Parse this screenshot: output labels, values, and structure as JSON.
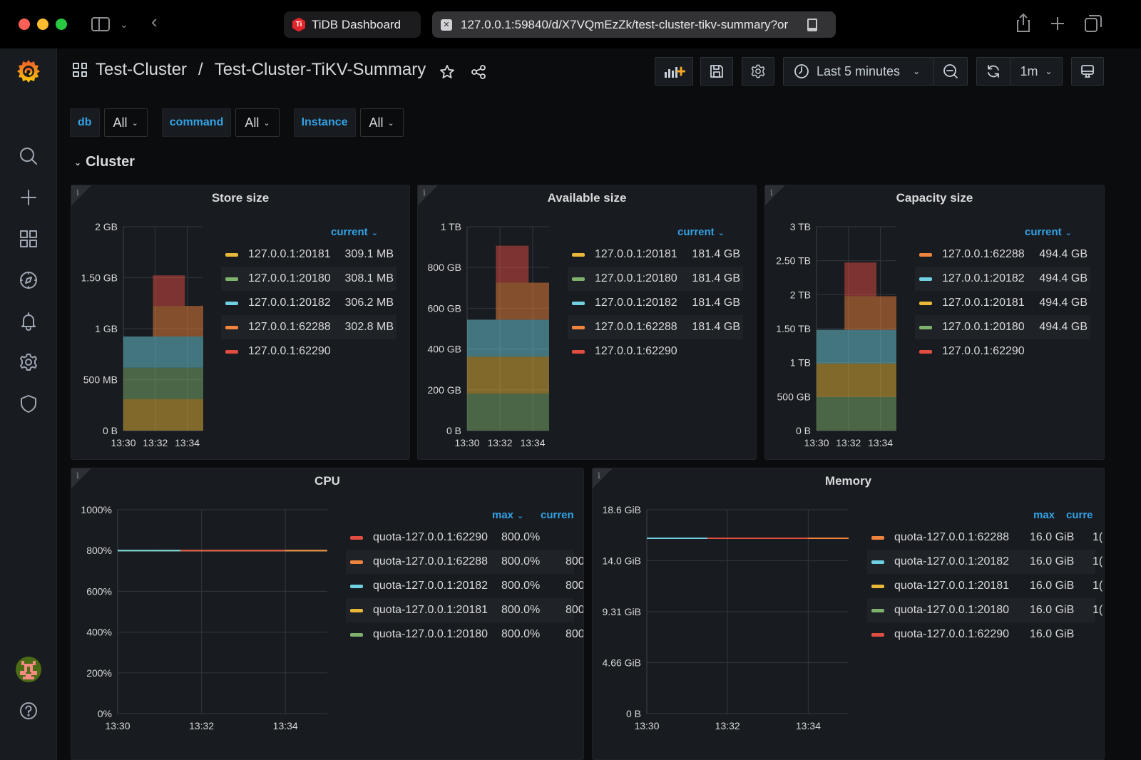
{
  "browser": {
    "tabs": [
      {
        "label": "TiDB Dashboard",
        "icon": "tidb-logo"
      },
      {
        "label": "127.0.0.1:59840/d/X7VQmEzZk/test-cluster-tikv-summary?or",
        "icon": "close-icon"
      }
    ]
  },
  "breadcrumb": {
    "folder": "Test-Cluster",
    "separator": "/",
    "dashboard": "Test-Cluster-TiKV-Summary"
  },
  "toolbar": {
    "time_range": "Last 5 minutes",
    "refresh_interval": "1m"
  },
  "variables": [
    {
      "label": "db",
      "value": "All"
    },
    {
      "label": "command",
      "value": "All"
    },
    {
      "label": "Instance",
      "value": "All"
    }
  ],
  "row": {
    "title": "Cluster"
  },
  "colors": {
    "yellow": "#eab839",
    "green": "#7eb26d",
    "cyan": "#6ed0e0",
    "orange": "#ef843c",
    "red": "#e24d42",
    "accent": "#33a2e5"
  },
  "chart_data": [
    {
      "type": "area",
      "title": "Store size",
      "stacked": true,
      "x": [
        "13:30",
        "13:31",
        "13:32",
        "13:33",
        "13:34",
        "13:35"
      ],
      "xticks": [
        "13:30",
        "13:32",
        "13:34"
      ],
      "yticks": [
        "0 B",
        "500 MB",
        "1 GB",
        "1.50 GB",
        "2 GB"
      ],
      "ylim": [
        0,
        2
      ],
      "yunit": "GB",
      "legend_header": "current",
      "series": [
        {
          "name": "127.0.0.1:20181",
          "color": "#eab839",
          "current": "309.1 MB",
          "values": [
            0.309,
            0.309,
            0.309,
            0.309,
            0.309,
            0.309
          ]
        },
        {
          "name": "127.0.0.1:20180",
          "color": "#7eb26d",
          "current": "308.1 MB",
          "values": [
            0.308,
            0.308,
            0.308,
            0.308,
            0.308,
            0.308
          ]
        },
        {
          "name": "127.0.0.1:20182",
          "color": "#6ed0e0",
          "current": "306.2 MB",
          "values": [
            0.306,
            0.306,
            0.306,
            0.306,
            0.306,
            0.306
          ]
        },
        {
          "name": "127.0.0.1:62288",
          "color": "#ef843c",
          "current": "302.8 MB",
          "values": [
            0,
            0,
            0.3,
            0.3,
            0.3,
            0.303
          ]
        },
        {
          "name": "127.0.0.1:62290",
          "color": "#e24d42",
          "current": "",
          "values": [
            0,
            0,
            0.3,
            0.3,
            0,
            0
          ]
        }
      ]
    },
    {
      "type": "area",
      "title": "Available size",
      "stacked": true,
      "x": [
        "13:30",
        "13:31",
        "13:32",
        "13:33",
        "13:34",
        "13:35"
      ],
      "xticks": [
        "13:30",
        "13:32",
        "13:34"
      ],
      "yticks": [
        "0 B",
        "200 GB",
        "400 GB",
        "600 GB",
        "800 GB",
        "1 TB"
      ],
      "ylim": [
        0,
        1000
      ],
      "yunit": "GB",
      "legend_header": "current",
      "series": [
        {
          "name": "127.0.0.1:20181",
          "color": "#eab839",
          "current": "181.4 GB",
          "values": [
            181.4,
            181.4,
            181.4,
            181.4,
            181.4,
            181.4
          ]
        },
        {
          "name": "127.0.0.1:20180",
          "color": "#7eb26d",
          "current": "181.4 GB",
          "values": [
            181.4,
            181.4,
            181.4,
            181.4,
            181.4,
            181.4
          ]
        },
        {
          "name": "127.0.0.1:20182",
          "color": "#6ed0e0",
          "current": "181.4 GB",
          "values": [
            181.4,
            181.4,
            181.4,
            181.4,
            181.4,
            181.4
          ]
        },
        {
          "name": "127.0.0.1:62288",
          "color": "#ef843c",
          "current": "181.4 GB",
          "values": [
            0,
            0,
            181.4,
            181.4,
            181.4,
            181.4
          ]
        },
        {
          "name": "127.0.0.1:62290",
          "color": "#e24d42",
          "current": "",
          "values": [
            0,
            0,
            181.4,
            181.4,
            0,
            0
          ]
        }
      ]
    },
    {
      "type": "area",
      "title": "Capacity size",
      "stacked": true,
      "x": [
        "13:30",
        "13:31",
        "13:32",
        "13:33",
        "13:34",
        "13:35"
      ],
      "xticks": [
        "13:30",
        "13:32",
        "13:34"
      ],
      "yticks": [
        "0 B",
        "500 GB",
        "1 TB",
        "1.50 TB",
        "2 TB",
        "2.50 TB",
        "3 TB"
      ],
      "ylim": [
        0,
        3000
      ],
      "yunit": "GB",
      "legend_header": "current",
      "series": [
        {
          "name": "127.0.0.1:62288",
          "color": "#ef843c",
          "current": "494.4 GB",
          "values": [
            0,
            0,
            494.4,
            494.4,
            494.4,
            494.4
          ]
        },
        {
          "name": "127.0.0.1:20182",
          "color": "#6ed0e0",
          "current": "494.4 GB",
          "values": [
            494.4,
            494.4,
            494.4,
            494.4,
            494.4,
            494.4
          ]
        },
        {
          "name": "127.0.0.1:20181",
          "color": "#eab839",
          "current": "494.4 GB",
          "values": [
            494.4,
            494.4,
            494.4,
            494.4,
            494.4,
            494.4
          ]
        },
        {
          "name": "127.0.0.1:20180",
          "color": "#7eb26d",
          "current": "494.4 GB",
          "values": [
            494.4,
            494.4,
            494.4,
            494.4,
            494.4,
            494.4
          ]
        },
        {
          "name": "127.0.0.1:62290",
          "color": "#e24d42",
          "current": "",
          "values": [
            0,
            0,
            494.4,
            494.4,
            0,
            0
          ]
        }
      ],
      "stack_order": [
        "127.0.0.1:20180",
        "127.0.0.1:20181",
        "127.0.0.1:20182",
        "127.0.0.1:62288",
        "127.0.0.1:62290"
      ]
    },
    {
      "type": "line",
      "title": "CPU",
      "x": [
        "13:30",
        "13:31",
        "13:32",
        "13:33",
        "13:34",
        "13:35"
      ],
      "xticks": [
        "13:30",
        "13:32",
        "13:34"
      ],
      "yticks": [
        "0%",
        "200%",
        "400%",
        "600%",
        "800%",
        "1000%"
      ],
      "ylim": [
        0,
        1000
      ],
      "legend_headers": [
        "max",
        "curren"
      ],
      "series": [
        {
          "name": "quota-127.0.0.1:62290",
          "color": "#e24d42",
          "max": "800.0%",
          "current": "",
          "values": [
            null,
            800,
            800,
            800,
            800,
            null
          ]
        },
        {
          "name": "quota-127.0.0.1:62288",
          "color": "#ef843c",
          "max": "800.0%",
          "current": "800.",
          "values": [
            null,
            800,
            800,
            800,
            800,
            800
          ]
        },
        {
          "name": "quota-127.0.0.1:20182",
          "color": "#6ed0e0",
          "max": "800.0%",
          "current": "800.",
          "values": [
            800,
            800,
            800,
            800,
            800,
            800
          ]
        },
        {
          "name": "quota-127.0.0.1:20181",
          "color": "#eab839",
          "max": "800.0%",
          "current": "800.",
          "values": [
            800,
            800,
            800,
            800,
            800,
            800
          ]
        },
        {
          "name": "quota-127.0.0.1:20180",
          "color": "#7eb26d",
          "max": "800.0%",
          "current": "800.",
          "values": [
            800,
            800,
            800,
            800,
            800,
            800
          ]
        }
      ]
    },
    {
      "type": "line",
      "title": "Memory",
      "x": [
        "13:30",
        "13:31",
        "13:32",
        "13:33",
        "13:34",
        "13:35"
      ],
      "xticks": [
        "13:30",
        "13:32",
        "13:34"
      ],
      "yticks": [
        "0 B",
        "4.66 GiB",
        "9.31 GiB",
        "14.0 GiB",
        "18.6 GiB"
      ],
      "ylim": [
        0,
        18.6
      ],
      "legend_headers": [
        "max",
        "curre"
      ],
      "series": [
        {
          "name": "quota-127.0.0.1:62288",
          "color": "#ef843c",
          "max": "16.0 GiB",
          "current": "1(",
          "values": [
            null,
            16,
            16,
            16,
            16,
            16
          ]
        },
        {
          "name": "quota-127.0.0.1:20182",
          "color": "#6ed0e0",
          "max": "16.0 GiB",
          "current": "1(",
          "values": [
            16,
            16,
            16,
            16,
            16,
            16
          ]
        },
        {
          "name": "quota-127.0.0.1:20181",
          "color": "#eab839",
          "max": "16.0 GiB",
          "current": "1(",
          "values": [
            16,
            16,
            16,
            16,
            16,
            16
          ]
        },
        {
          "name": "quota-127.0.0.1:20180",
          "color": "#7eb26d",
          "max": "16.0 GiB",
          "current": "1(",
          "values": [
            16,
            16,
            16,
            16,
            16,
            16
          ]
        },
        {
          "name": "quota-127.0.0.1:62290",
          "color": "#e24d42",
          "max": "16.0 GiB",
          "current": "",
          "values": [
            null,
            16,
            16,
            16,
            16,
            null
          ]
        }
      ]
    }
  ]
}
